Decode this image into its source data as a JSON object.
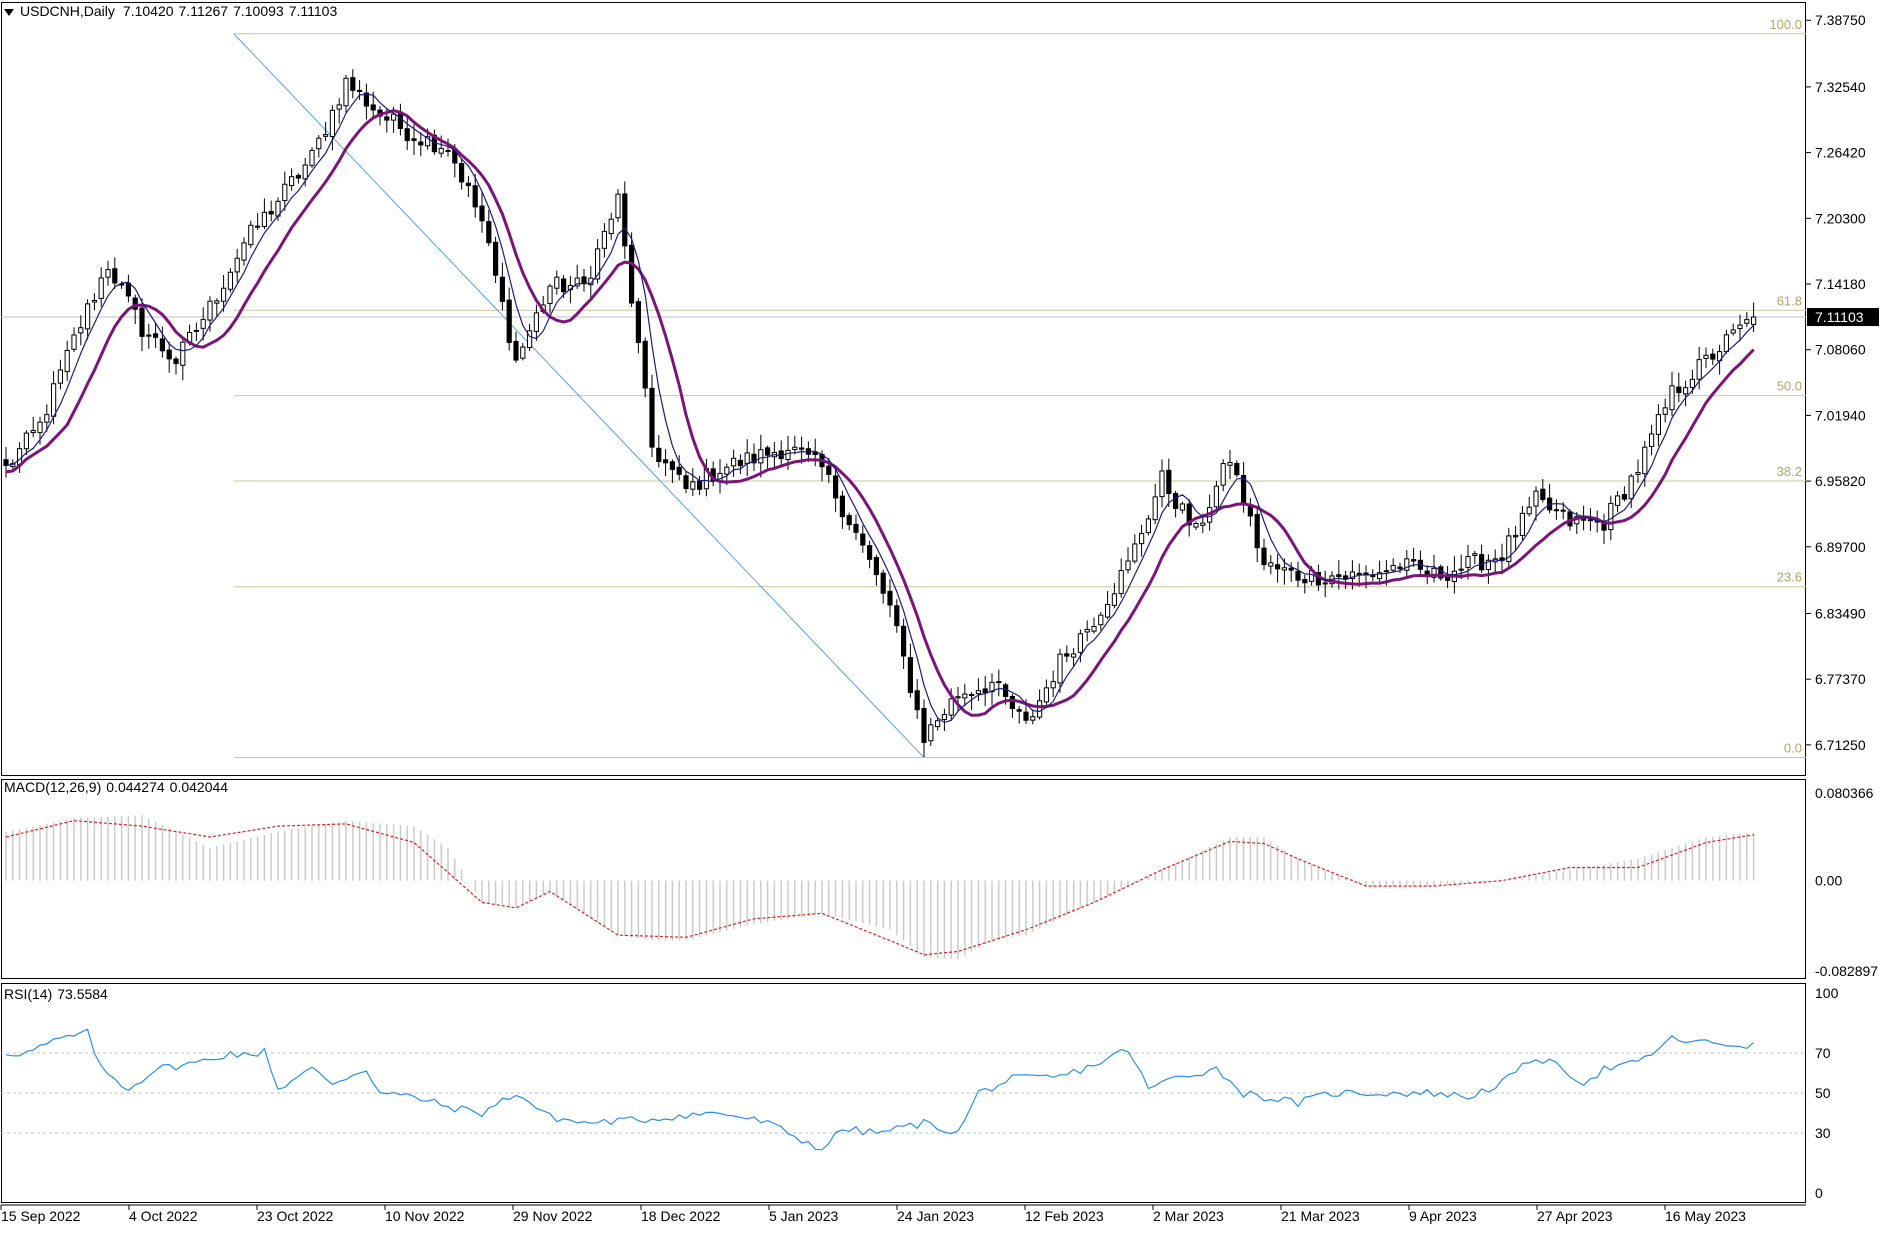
{
  "header": {
    "symbol": "USDCNH,Daily",
    "open": "7.10420",
    "high": "7.11267",
    "low": "7.10093",
    "close": "7.11103"
  },
  "macd_header": {
    "label": "MACD(12,26,9)",
    "main": "0.044274",
    "signal": "0.042044"
  },
  "rsi_header": {
    "label": "RSI(14)",
    "value": "73.5584"
  },
  "colors": {
    "fast_ma": "#1f1a7a",
    "slow_ma": "#7b1479",
    "fib": "#c8c89a",
    "fib_text": "#b4a46a",
    "macd_hist": "#c8c8c8",
    "macd_signal": "#e02020",
    "rsi": "#2a8ee8",
    "trend": "#5aa0e8"
  },
  "chart_data": [
    {
      "type": "candlestick",
      "name": "USDCNH,Daily",
      "price_axis_labels": [
        "7.38750",
        "7.32540",
        "7.26420",
        "7.20300",
        "7.14180",
        "7.08060",
        "7.01940",
        "6.95820",
        "6.89700",
        "6.83490",
        "6.77370",
        "6.71250"
      ],
      "current_price": "7.11103",
      "ylim": [
        6.6835,
        7.4045
      ],
      "date_labels": [
        "15 Sep 2022",
        "4 Oct 2022",
        "23 Oct 2022",
        "10 Nov 2022",
        "29 Nov 2022",
        "18 Dec 2022",
        "5 Jan 2023",
        "24 Jan 2023",
        "12 Feb 2023",
        "2 Mar 2023",
        "21 Mar 2023",
        "9 Apr 2023",
        "27 Apr 2023",
        "16 May 2023"
      ],
      "fibonacci": {
        "high": 7.3749,
        "low": 6.7007,
        "levels": [
          {
            "label": "100.0",
            "value": 7.3749
          },
          {
            "label": "61.8",
            "value": 7.1173
          },
          {
            "label": "50.0",
            "value": 7.0378
          },
          {
            "label": "38.2",
            "value": 6.9583
          },
          {
            "label": "23.6",
            "value": 6.8598
          },
          {
            "label": "0.0",
            "value": 6.7007
          }
        ]
      },
      "trendline": {
        "from": 7.3749,
        "to": 6.7007
      },
      "close_path": [
        [
          0,
          6.97
        ],
        [
          5,
          7.01
        ],
        [
          10,
          7.09
        ],
        [
          15,
          7.16
        ],
        [
          20,
          7.1
        ],
        [
          25,
          7.07
        ],
        [
          30,
          7.12
        ],
        [
          35,
          7.18
        ],
        [
          40,
          7.22
        ],
        [
          45,
          7.26
        ],
        [
          50,
          7.33
        ],
        [
          55,
          7.3
        ],
        [
          60,
          7.28
        ],
        [
          65,
          7.27
        ],
        [
          70,
          7.2
        ],
        [
          75,
          7.07
        ],
        [
          80,
          7.14
        ],
        [
          85,
          7.14
        ],
        [
          90,
          7.22
        ],
        [
          95,
          6.99
        ],
        [
          100,
          6.95
        ],
        [
          105,
          6.97
        ],
        [
          110,
          6.98
        ],
        [
          115,
          6.99
        ],
        [
          120,
          6.97
        ],
        [
          125,
          6.91
        ],
        [
          130,
          6.84
        ],
        [
          135,
          6.72
        ],
        [
          140,
          6.76
        ],
        [
          145,
          6.77
        ],
        [
          150,
          6.73
        ],
        [
          155,
          6.79
        ],
        [
          160,
          6.83
        ],
        [
          165,
          6.88
        ],
        [
          170,
          6.96
        ],
        [
          175,
          6.91
        ],
        [
          180,
          6.98
        ],
        [
          185,
          6.88
        ],
        [
          190,
          6.87
        ],
        [
          195,
          6.87
        ],
        [
          200,
          6.87
        ],
        [
          205,
          6.88
        ],
        [
          210,
          6.87
        ],
        [
          215,
          6.88
        ],
        [
          220,
          6.89
        ],
        [
          225,
          6.94
        ],
        [
          230,
          6.92
        ],
        [
          235,
          6.92
        ],
        [
          240,
          6.97
        ],
        [
          245,
          7.04
        ],
        [
          250,
          7.07
        ],
        [
          255,
          7.1
        ],
        [
          257,
          7.11
        ]
      ],
      "candle_count": 258,
      "ma_periods": [
        5,
        10
      ]
    },
    {
      "type": "histogram+line",
      "name": "MACD(12,26,9)",
      "axis_labels": [
        "0.080366",
        "0.00",
        "-0.082897"
      ],
      "ylim": [
        -0.082897,
        0.080366
      ],
      "main_path": [
        [
          0,
          0.045
        ],
        [
          10,
          0.057
        ],
        [
          20,
          0.06
        ],
        [
          30,
          0.03
        ],
        [
          40,
          0.045
        ],
        [
          50,
          0.055
        ],
        [
          60,
          0.05
        ],
        [
          65,
          0.03
        ],
        [
          70,
          -0.02
        ],
        [
          75,
          -0.025
        ],
        [
          80,
          -0.01
        ],
        [
          90,
          -0.05
        ],
        [
          95,
          -0.055
        ],
        [
          100,
          -0.055
        ],
        [
          110,
          -0.04
        ],
        [
          120,
          -0.03
        ],
        [
          130,
          -0.045
        ],
        [
          135,
          -0.07
        ],
        [
          140,
          -0.072
        ],
        [
          145,
          -0.055
        ],
        [
          150,
          -0.05
        ],
        [
          160,
          -0.02
        ],
        [
          170,
          0.01
        ],
        [
          180,
          0.04
        ],
        [
          185,
          0.04
        ],
        [
          190,
          0.02
        ],
        [
          200,
          -0.005
        ],
        [
          210,
          -0.005
        ],
        [
          220,
          0.0
        ],
        [
          230,
          0.01
        ],
        [
          240,
          0.02
        ],
        [
          250,
          0.04
        ],
        [
          257,
          0.044
        ]
      ],
      "signal_path": [
        [
          0,
          0.04
        ],
        [
          10,
          0.055
        ],
        [
          20,
          0.05
        ],
        [
          30,
          0.04
        ],
        [
          40,
          0.05
        ],
        [
          50,
          0.052
        ],
        [
          60,
          0.035
        ],
        [
          70,
          -0.02
        ],
        [
          75,
          -0.025
        ],
        [
          80,
          -0.01
        ],
        [
          90,
          -0.05
        ],
        [
          100,
          -0.052
        ],
        [
          110,
          -0.035
        ],
        [
          120,
          -0.03
        ],
        [
          130,
          -0.055
        ],
        [
          135,
          -0.068
        ],
        [
          140,
          -0.065
        ],
        [
          150,
          -0.045
        ],
        [
          160,
          -0.02
        ],
        [
          170,
          0.01
        ],
        [
          180,
          0.036
        ],
        [
          185,
          0.034
        ],
        [
          190,
          0.02
        ],
        [
          200,
          -0.005
        ],
        [
          210,
          -0.005
        ],
        [
          220,
          0.0
        ],
        [
          230,
          0.012
        ],
        [
          240,
          0.012
        ],
        [
          250,
          0.035
        ],
        [
          257,
          0.042
        ]
      ]
    },
    {
      "type": "line",
      "name": "RSI(14)",
      "axis_labels": [
        "100",
        "70",
        "50",
        "30",
        "0"
      ],
      "ylim": [
        0,
        100
      ],
      "levels": [
        70,
        50,
        30
      ],
      "path": [
        [
          0,
          70
        ],
        [
          3,
          70
        ],
        [
          8,
          77
        ],
        [
          12,
          80
        ],
        [
          14,
          62
        ],
        [
          18,
          52
        ],
        [
          22,
          62
        ],
        [
          28,
          65
        ],
        [
          33,
          70
        ],
        [
          36,
          68
        ],
        [
          38,
          72
        ],
        [
          40,
          52
        ],
        [
          45,
          62
        ],
        [
          48,
          55
        ],
        [
          53,
          62
        ],
        [
          55,
          50
        ],
        [
          60,
          48
        ],
        [
          65,
          43
        ],
        [
          70,
          40
        ],
        [
          75,
          50
        ],
        [
          80,
          38
        ],
        [
          85,
          35
        ],
        [
          90,
          36
        ],
        [
          95,
          37
        ],
        [
          100,
          39
        ],
        [
          105,
          40
        ],
        [
          108,
          38
        ],
        [
          112,
          35
        ],
        [
          118,
          25
        ],
        [
          120,
          22
        ],
        [
          123,
          32
        ],
        [
          128,
          30
        ],
        [
          135,
          35
        ],
        [
          140,
          30
        ],
        [
          143,
          50
        ],
        [
          148,
          57
        ],
        [
          155,
          58
        ],
        [
          160,
          64
        ],
        [
          165,
          72
        ],
        [
          168,
          52
        ],
        [
          172,
          58
        ],
        [
          178,
          62
        ],
        [
          182,
          50
        ],
        [
          185,
          48
        ],
        [
          190,
          45
        ],
        [
          195,
          50
        ],
        [
          200,
          50
        ],
        [
          205,
          50
        ],
        [
          210,
          50
        ],
        [
          215,
          48
        ],
        [
          220,
          55
        ],
        [
          225,
          68
        ],
        [
          229,
          62
        ],
        [
          232,
          55
        ],
        [
          235,
          62
        ],
        [
          240,
          65
        ],
        [
          245,
          77
        ],
        [
          250,
          75
        ],
        [
          257,
          73.5584
        ]
      ]
    }
  ]
}
